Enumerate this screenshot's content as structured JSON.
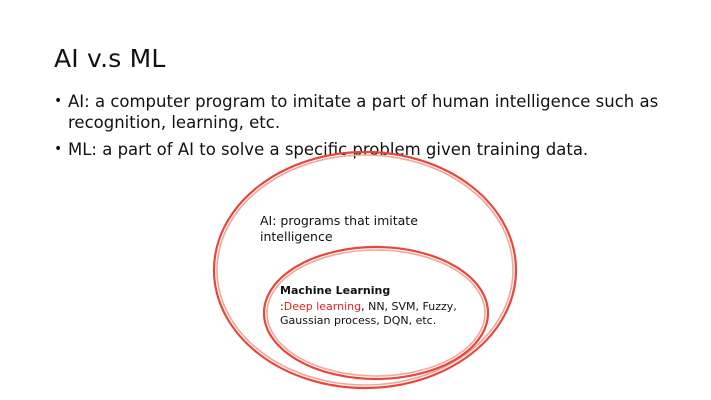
{
  "slide": {
    "title": "AI v.s ML",
    "bullets": [
      {
        "text": "AI: a computer program to imitate a part of human intelligence such as recognition, learning, etc."
      },
      {
        "text": "ML: a part of AI to solve a specific problem given training data."
      }
    ],
    "bullet_symbol": "•"
  },
  "diagram": {
    "outer_label": "AI: programs that imitate intelligence",
    "inner_title": "Machine Learning",
    "inner_prefix": ":",
    "inner_highlight": "Deep learning",
    "inner_rest": ", NN, SVM, Fuzzy, Gaussian process, DQN, etc.",
    "colors": {
      "ellipse_stroke": "#e8463a",
      "ellipse_inner_stroke": "#f6a59c",
      "highlight_text": "#e02020"
    }
  }
}
